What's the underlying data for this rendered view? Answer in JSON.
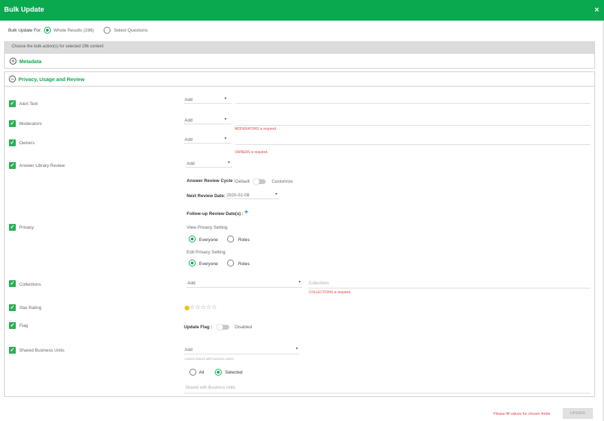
{
  "header": {
    "title": "Bulk Update",
    "close": "×"
  },
  "bulk_for": {
    "label": "Bulk Update For:",
    "whole": "Whole Results (296)",
    "select": "Select Questions"
  },
  "section_bar": "Choose the bulk action(s) for selected 296 content",
  "metadata": {
    "title": "Metadata",
    "icon": "+"
  },
  "privacy_section": {
    "title": "Privacy, Usage and Review",
    "icon": "−"
  },
  "fields": {
    "alert_text": {
      "label": "Alert Text",
      "select": "Add"
    },
    "moderators": {
      "label": "Moderators",
      "select": "Add",
      "error": "MODERATORS is required."
    },
    "owners": {
      "label": "Owners",
      "select": "Add",
      "error": "OWNERS is required."
    },
    "answer_library_review": {
      "label": "Answer Library Review",
      "select": "Add",
      "cycle_label": "Answer Review Cycle :",
      "cycle_default": "Default",
      "cycle_customize": "Customize",
      "next_label": "Next Review Date:",
      "next_value": "2020-01-08",
      "followup_label": "Follow-up Review Date(s) :",
      "followup_icon": "+"
    },
    "privacy": {
      "label": "Privacy",
      "view_label": "View Privacy Setting",
      "edit_label": "Edit Privacy Setting",
      "everyone": "Everyone",
      "roles": "Roles"
    },
    "collections": {
      "label": "Collections",
      "select": "Add",
      "placeholder": "Collections",
      "error": "COLLECTIONS is required."
    },
    "star_rating": {
      "label": "Star Rating",
      "stars": "☆☆☆☆☆",
      "value": 0
    },
    "flag": {
      "label": "Flag",
      "update_label": "Update Flag :",
      "state": "Disabled"
    },
    "shared_business_units": {
      "label": "Shared Business Units",
      "select": "Add",
      "hint": "content shared with business unit(s)",
      "all": "All",
      "selected": "Selected",
      "placeholder": "Shared with Business Units"
    }
  },
  "footer": {
    "message": "Please fill values for chosen fields",
    "update": "UPDATE"
  },
  "colors": {
    "brand": "#0aa84f",
    "error": "#e04040",
    "link": "#1a7fd4"
  },
  "check_glyph": "✓",
  "caret_glyph": "▾"
}
